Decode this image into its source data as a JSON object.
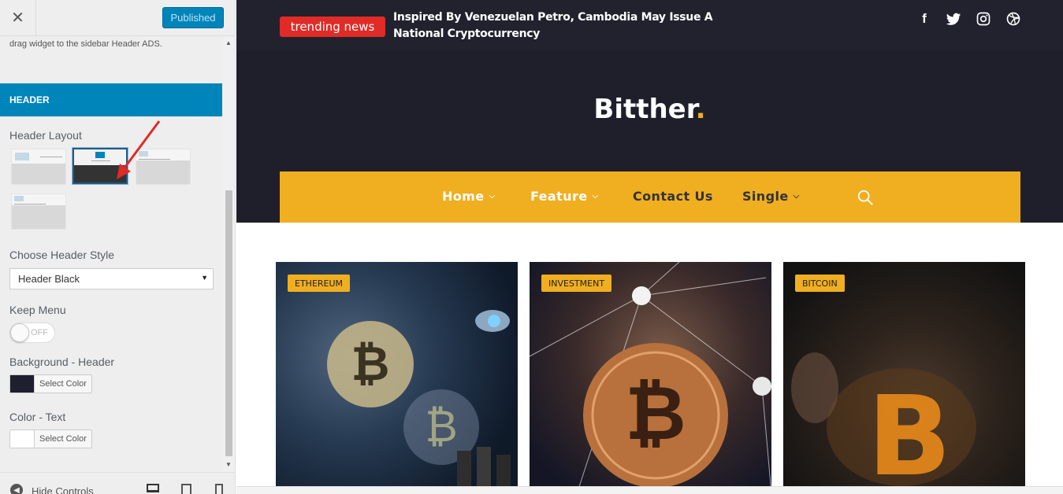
{
  "panel": {
    "close_icon": "close-icon",
    "publish_label": "Published",
    "drag_text": "drag widget to the sidebar Header ADS.",
    "section_title": "HEADER",
    "header_layout_label": "Header Layout",
    "choose_style_label": "Choose Header Style",
    "style_value": "Header Black",
    "keep_menu_label": "Keep Menu",
    "toggle_text": "OFF",
    "bg_header_label": "Background - Header",
    "bg_header_color": "#1f1f2e",
    "color_text_label": "Color - Text",
    "color_text_color": "#ffffff",
    "select_color_label": "Select Color",
    "hide_controls_label": "Hide Controls",
    "selected_layout": 2
  },
  "preview": {
    "trending_label": "trending news",
    "news_title": "Inspired By Venezuelan Petro, Cambodia May Issue A National Cryptocurrency",
    "brand_name": "Bitther",
    "brand_dot": ".",
    "social_icons": [
      "facebook-icon",
      "twitter-icon",
      "instagram-icon",
      "dribbble-icon"
    ],
    "nav": {
      "home": "Home",
      "feature": "Feature",
      "contact": "Contact Us",
      "single": "Single"
    },
    "cards": [
      {
        "tag": "ETHEREUM"
      },
      {
        "tag": "INVESTMENT"
      },
      {
        "tag": "BITCOIN"
      }
    ],
    "colors": {
      "accent": "#f0ae21",
      "header_bg": "#1f1f2b",
      "trending": "#e02b27",
      "customizer_blue": "#0085ba"
    }
  }
}
